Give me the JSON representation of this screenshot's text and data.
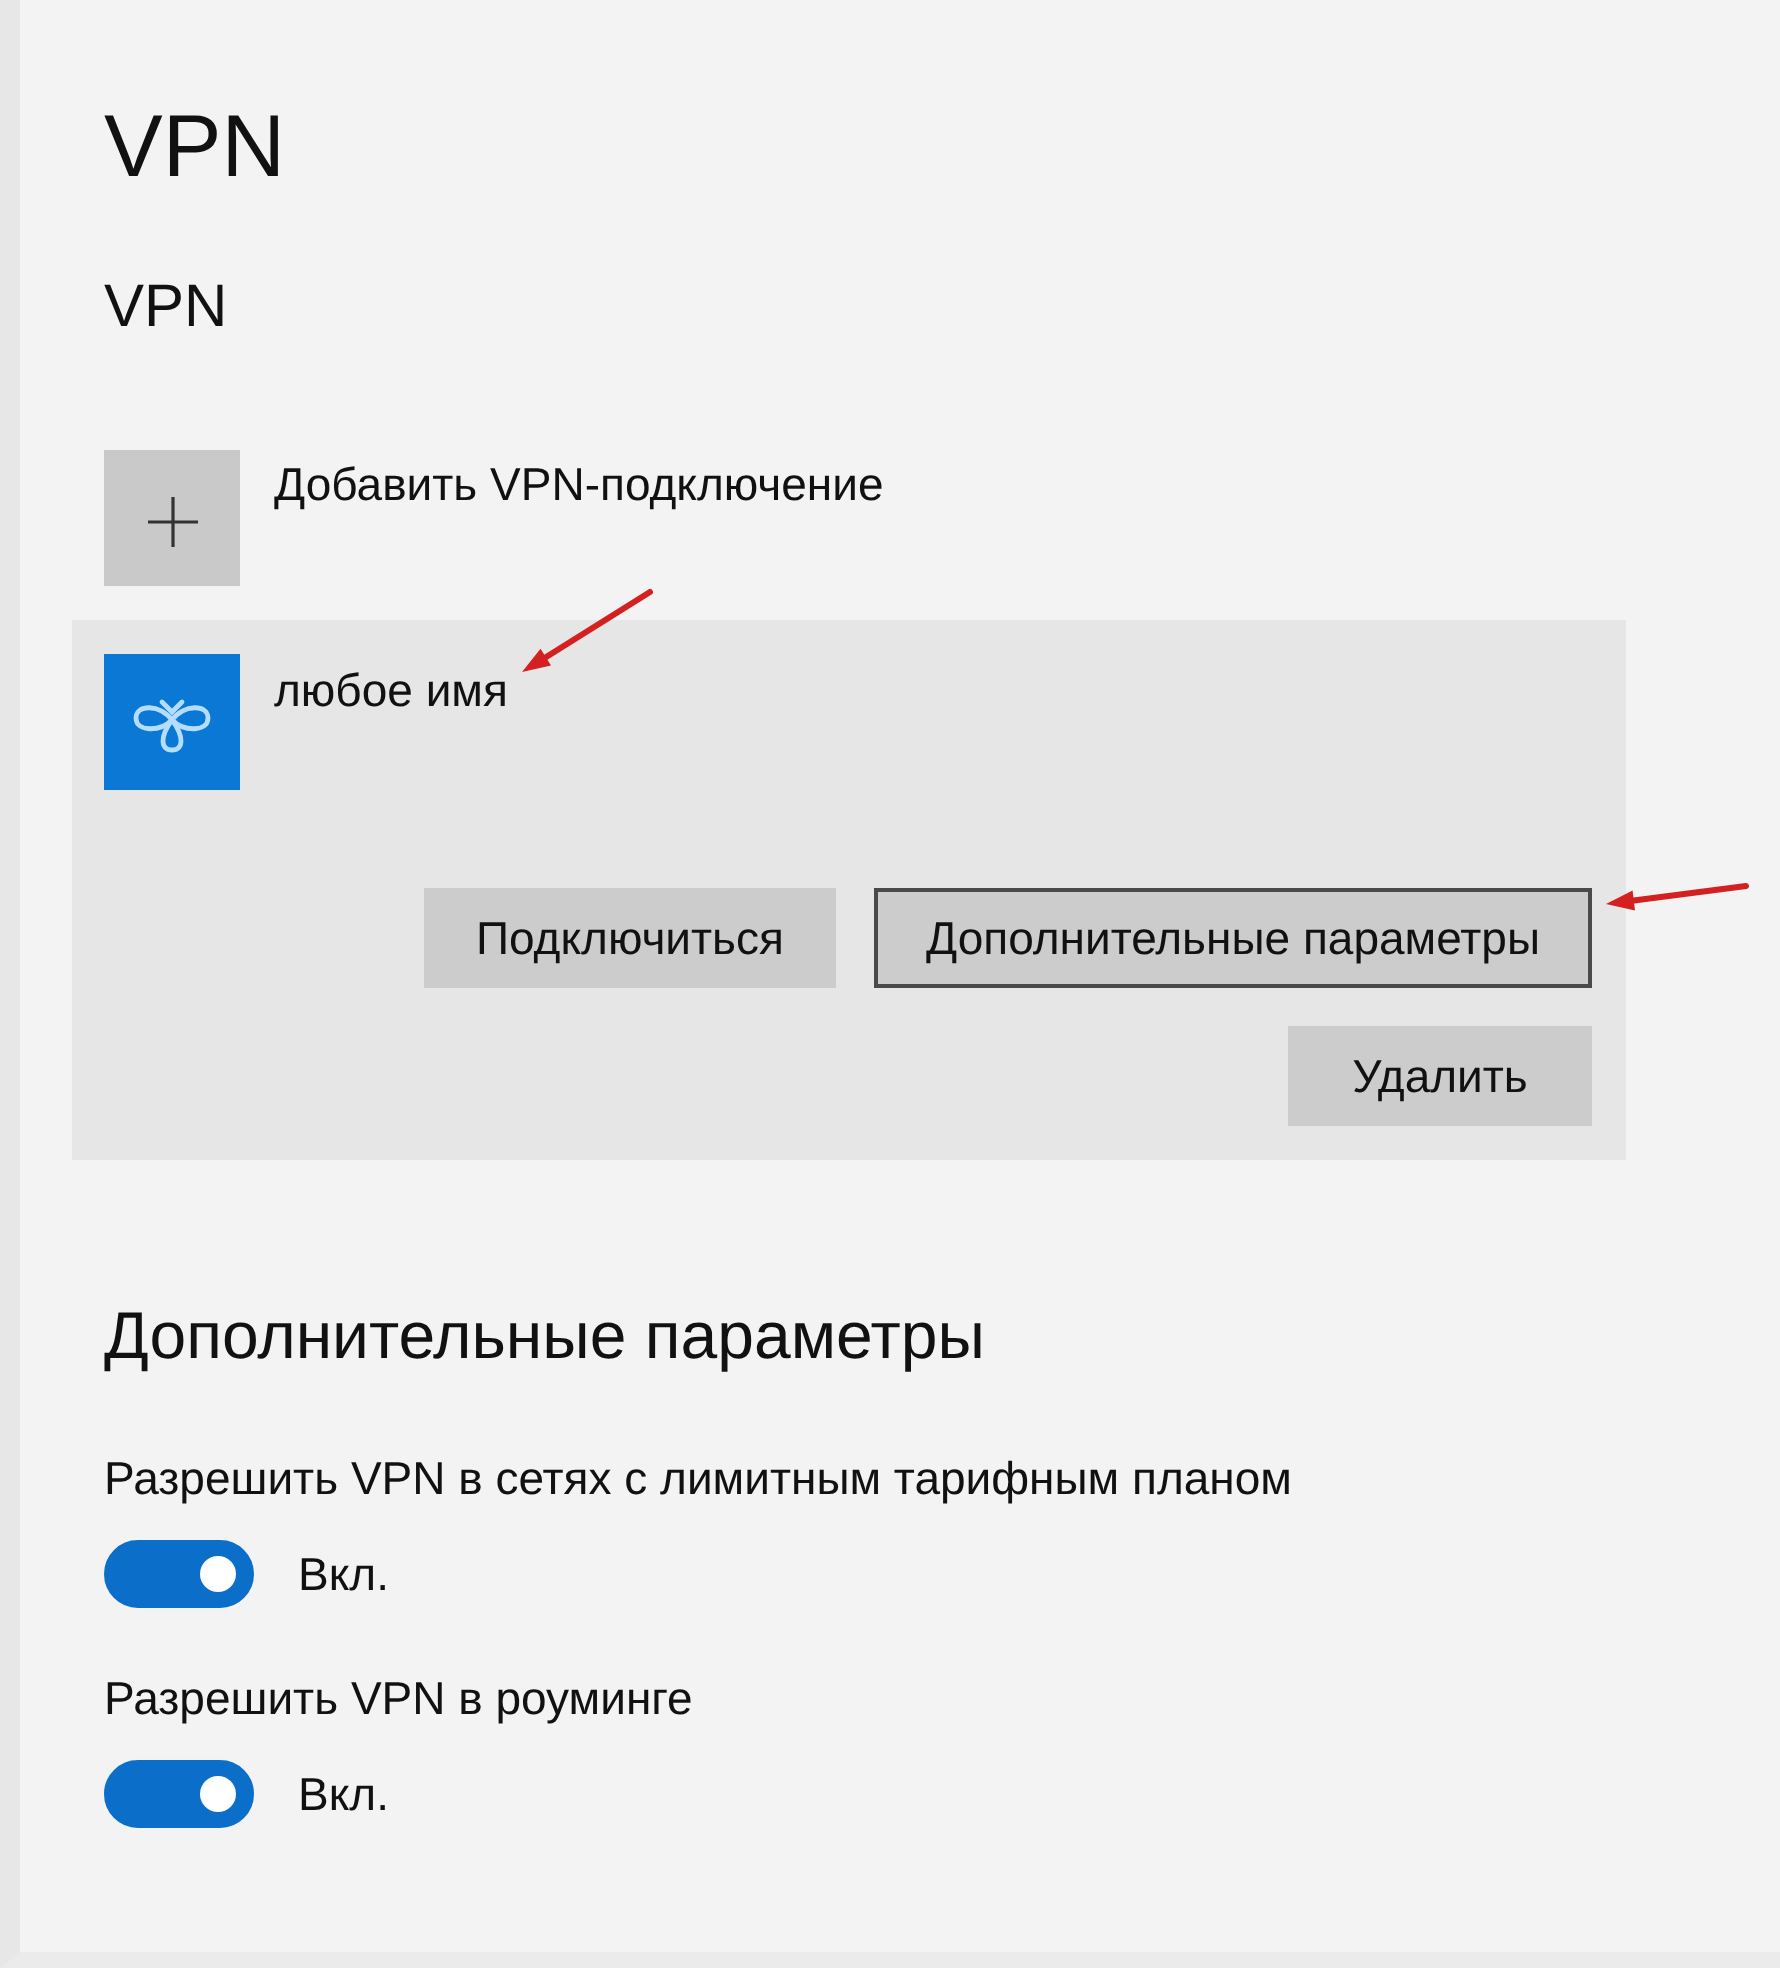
{
  "page": {
    "title": "VPN"
  },
  "vpn": {
    "heading": "VPN",
    "add_button": {
      "label": "Добавить VPN-подключение"
    },
    "connections": [
      {
        "name": "любое имя",
        "selected": true,
        "name_arrow": true,
        "buttons": [
          {
            "label": "Подключиться",
            "focused": false,
            "arrow": false
          },
          {
            "label": "Дополнительные параметры",
            "focused": true,
            "arrow": true
          },
          {
            "label": "Удалить",
            "focused": false,
            "arrow": false
          }
        ]
      }
    ]
  },
  "advanced": {
    "heading": "Дополнительные параметры",
    "settings": [
      {
        "label": "Разрешить VPN в сетях с лимитным тарифным планом",
        "on": true,
        "state_label": "Вкл."
      },
      {
        "label": "Разрешить VPN в роуминге",
        "on": true,
        "state_label": "Вкл."
      }
    ]
  }
}
